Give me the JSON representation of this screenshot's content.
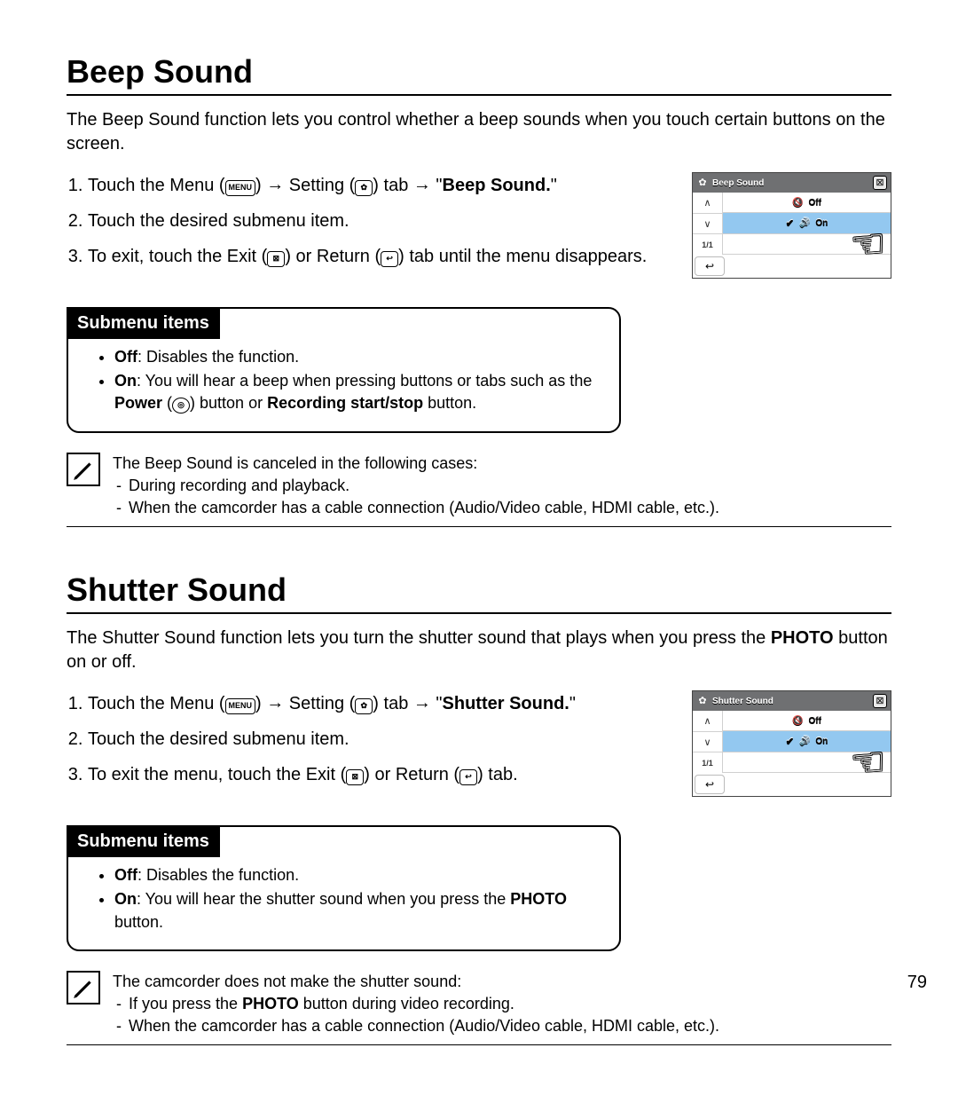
{
  "page_number": "79",
  "sections": [
    {
      "title": "Beep Sound",
      "intro": "The Beep Sound function lets you control whether a beep sounds when you touch certain buttons on the screen.",
      "steps": {
        "s1_a": "Touch the Menu (",
        "s1_menu_icon": "MENU",
        "s1_b": ") ",
        "s1_arrow1": "→",
        "s1_c": " Setting (",
        "s1_gear_icon": "✿",
        "s1_d": ") tab ",
        "s1_arrow2": "→",
        "s1_e": " \"",
        "s1_bold": "Beep Sound.",
        "s1_f": "\"",
        "s2": "Touch the desired submenu item.",
        "s3_a": "To exit, touch the Exit (",
        "s3_exit_icon": "⊠",
        "s3_b": ") or Return (",
        "s3_return_icon": "↩",
        "s3_c": ") tab until the menu disappears."
      },
      "screen": {
        "title": "Beep Sound",
        "off": "Off",
        "on": "On",
        "page": "1/1"
      },
      "submenu": {
        "label": "Submenu items",
        "off_b": "Off",
        "off_t": ": Disables the function.",
        "on_b": "On",
        "on_t_a": ": You will hear a beep when pressing buttons or tabs such as the ",
        "on_bold1": "Power",
        "on_t_b": " (",
        "on_power_icon": "◎",
        "on_t_c": ") button or ",
        "on_bold2": "Recording start/stop",
        "on_t_d": " button."
      },
      "note": {
        "lead": "The Beep Sound is canceled in the following cases:",
        "d1": "During recording and playback.",
        "d2": "When the camcorder has a cable connection (Audio/Video cable, HDMI cable, etc.)."
      }
    },
    {
      "title": "Shutter Sound",
      "intro_a": "The Shutter Sound function lets you turn the shutter sound that plays when you press the ",
      "intro_bold": "PHOTO",
      "intro_b": " button on or off.",
      "steps": {
        "s1_a": "Touch the Menu (",
        "s1_menu_icon": "MENU",
        "s1_b": ") ",
        "s1_arrow1": "→",
        "s1_c": " Setting (",
        "s1_gear_icon": "✿",
        "s1_d": ") tab ",
        "s1_arrow2": "→",
        "s1_e": " \"",
        "s1_bold": "Shutter Sound.",
        "s1_f": "\"",
        "s2": "Touch the desired submenu item.",
        "s3_a": "To exit the menu, touch the Exit (",
        "s3_exit_icon": "⊠",
        "s3_b": ") or Return (",
        "s3_return_icon": "↩",
        "s3_c": ") tab."
      },
      "screen": {
        "title": "Shutter Sound",
        "off": "Off",
        "on": "On",
        "page": "1/1"
      },
      "submenu": {
        "label": "Submenu items",
        "off_b": "Off",
        "off_t": ": Disables the function.",
        "on_b": "On",
        "on_t_a": ": You will hear the shutter sound when you press the ",
        "on_bold1": "PHOTO",
        "on_t_b": " button."
      },
      "note": {
        "lead": "The camcorder does not make the shutter sound:",
        "d1_a": "If you press the ",
        "d1_bold": "PHOTO",
        "d1_b": " button during video recording.",
        "d2": "When the camcorder has a cable connection (Audio/Video cable, HDMI cable, etc.)."
      }
    }
  ]
}
